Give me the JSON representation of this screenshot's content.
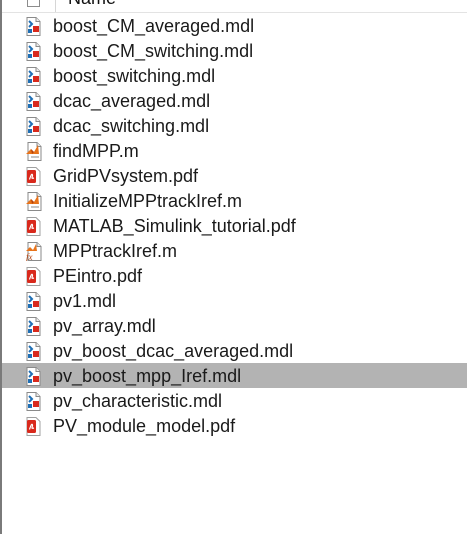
{
  "header": {
    "column_name": "Name"
  },
  "files": [
    {
      "name": "boost_CM_averaged.mdl",
      "icon": "simulink-model-icon",
      "selected": false
    },
    {
      "name": "boost_CM_switching.mdl",
      "icon": "simulink-model-icon",
      "selected": false
    },
    {
      "name": "boost_switching.mdl",
      "icon": "simulink-model-icon",
      "selected": false
    },
    {
      "name": "dcac_averaged.mdl",
      "icon": "simulink-model-icon",
      "selected": false
    },
    {
      "name": "dcac_switching.mdl",
      "icon": "simulink-model-icon",
      "selected": false
    },
    {
      "name": "findMPP.m",
      "icon": "matlab-script-icon",
      "selected": false
    },
    {
      "name": "GridPVsystem.pdf",
      "icon": "pdf-file-icon",
      "selected": false
    },
    {
      "name": "InitializeMPPtrackIref.m",
      "icon": "matlab-script-icon",
      "selected": false
    },
    {
      "name": "MATLAB_Simulink_tutorial.pdf",
      "icon": "pdf-file-icon",
      "selected": false
    },
    {
      "name": "MPPtrackIref.m",
      "icon": "matlab-function-icon",
      "selected": false
    },
    {
      "name": "PEintro.pdf",
      "icon": "pdf-file-icon",
      "selected": false
    },
    {
      "name": "pv1.mdl",
      "icon": "simulink-model-icon",
      "selected": false
    },
    {
      "name": "pv_array.mdl",
      "icon": "simulink-model-icon",
      "selected": false
    },
    {
      "name": "pv_boost_dcac_averaged.mdl",
      "icon": "simulink-model-icon",
      "selected": false
    },
    {
      "name": "pv_boost_mpp_Iref.mdl",
      "icon": "simulink-model-icon",
      "selected": true
    },
    {
      "name": "pv_characteristic.mdl",
      "icon": "simulink-model-icon",
      "selected": false
    },
    {
      "name": "PV_module_model.pdf",
      "icon": "pdf-file-icon",
      "selected": false
    }
  ],
  "colors": {
    "selection": "#b3b3b3",
    "pdf_red": "#d9291c",
    "matlab_orange": "#e8731a",
    "simulink_blue": "#1f6fb5"
  }
}
